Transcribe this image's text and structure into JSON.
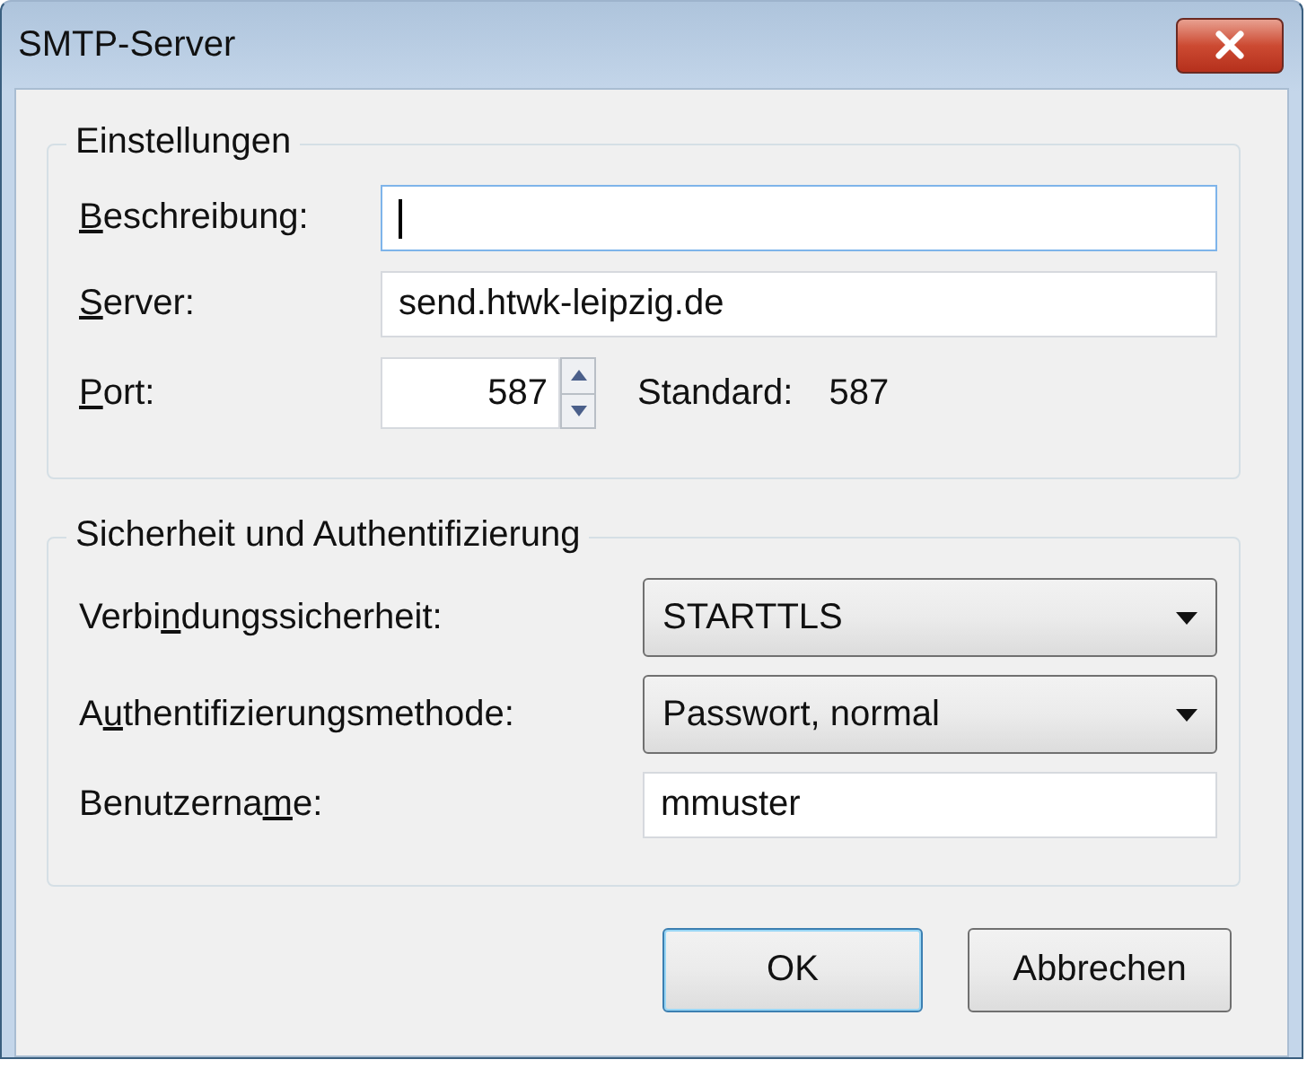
{
  "window": {
    "title": "SMTP-Server"
  },
  "groups": [
    {
      "title": "Einstellungen",
      "rows": [
        {
          "kind": "text",
          "label": {
            "key": "B",
            "after": "eschreibung:"
          },
          "value": "",
          "focused": true
        },
        {
          "kind": "text",
          "label": {
            "key": "S",
            "after": "erver:"
          },
          "value": "send.htwk-leipzig.de",
          "focused": false
        },
        {
          "kind": "spin",
          "label": {
            "key": "P",
            "after": "ort:"
          },
          "value": "587",
          "note_label": "Standard:",
          "note_value": "587"
        }
      ]
    },
    {
      "title": "Sicherheit und Authentifizierung",
      "rows": [
        {
          "kind": "select",
          "label": {
            "before": "Verbi",
            "key": "n",
            "after": "dungssicherheit:"
          },
          "value": "STARTTLS"
        },
        {
          "kind": "select",
          "label": {
            "before": "A",
            "key": "u",
            "after": "thentifizierungsmethode:"
          },
          "value": "Passwort, normal"
        },
        {
          "kind": "text",
          "label": {
            "before": "Benutzerna",
            "key": "m",
            "after": "e:"
          },
          "value": "mmuster",
          "focused": false
        }
      ]
    }
  ],
  "buttons": [
    {
      "label": "OK",
      "default": true
    },
    {
      "label": "Abbrechen",
      "default": false
    }
  ]
}
